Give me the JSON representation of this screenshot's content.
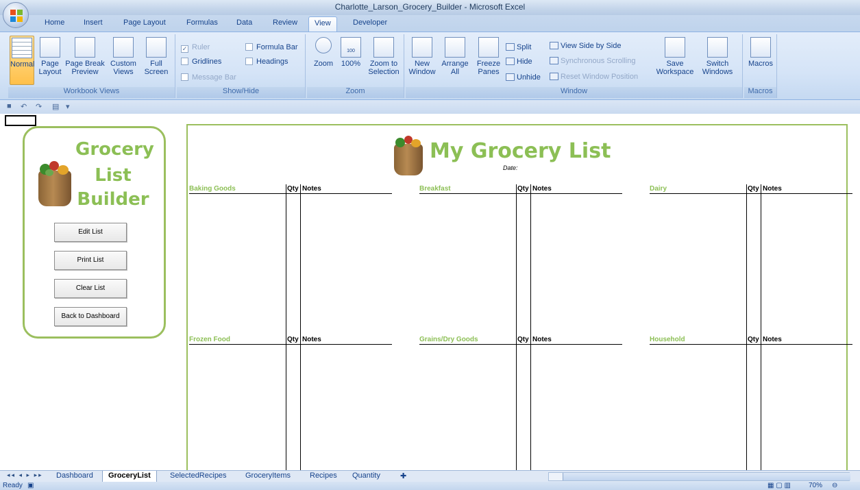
{
  "window": {
    "title": "Charlotte_Larson_Grocery_Builder - Microsoft Excel"
  },
  "ribbon_tabs": [
    "Home",
    "Insert",
    "Page Layout",
    "Formulas",
    "Data",
    "Review",
    "View",
    "Developer"
  ],
  "active_tab": "View",
  "ribbon": {
    "workbook_views": {
      "label": "Workbook Views",
      "normal": "Normal",
      "page_layout": "Page Layout",
      "page_break_preview": "Page Break Preview",
      "custom_views": "Custom Views",
      "full_screen": "Full Screen"
    },
    "show_hide": {
      "label": "Show/Hide",
      "ruler": "Ruler",
      "gridlines": "Gridlines",
      "message_bar": "Message Bar",
      "formula_bar": "Formula Bar",
      "headings": "Headings"
    },
    "zoom": {
      "label": "Zoom",
      "zoom": "Zoom",
      "hundred": "100%",
      "zoom_to_selection": "Zoom to Selection",
      "hundred_icon_text": "100"
    },
    "window": {
      "label": "Window",
      "new_window": "New Window",
      "arrange_all": "Arrange All",
      "freeze_panes": "Freeze Panes",
      "split": "Split",
      "hide": "Hide",
      "unhide": "Unhide",
      "view_side_by_side": "View Side by Side",
      "synchronous_scrolling": "Synchronous Scrolling",
      "reset_window_position": "Reset Window Position",
      "save_workspace": "Save Workspace",
      "switch_windows": "Switch Windows"
    },
    "macros": {
      "label": "Macros",
      "macros": "Macros"
    }
  },
  "builder": {
    "title_lines": [
      "Grocery",
      "List",
      "Builder"
    ],
    "buttons": [
      "Edit List",
      "Print List",
      "Clear List",
      "Back to Dashboard"
    ]
  },
  "grocery_list": {
    "title": "My Grocery List",
    "date_label": "Date:",
    "qty_header": "Qty",
    "notes_header": "Notes",
    "sections": [
      "Baking Goods",
      "Breakfast",
      "Dairy",
      "Frozen Food",
      "Grains/Dry Goods",
      "Household"
    ]
  },
  "sheet_tabs": [
    "Dashboard",
    "GroceryList",
    "SelectedRecipes",
    "GroceryItems",
    "Recipes",
    "Quantity"
  ],
  "active_sheet": "GroceryList",
  "status": {
    "ready": "Ready",
    "zoom": "70%"
  },
  "colors": {
    "accent_green": "#8cbf55",
    "ribbon_blue": "#15428b"
  }
}
